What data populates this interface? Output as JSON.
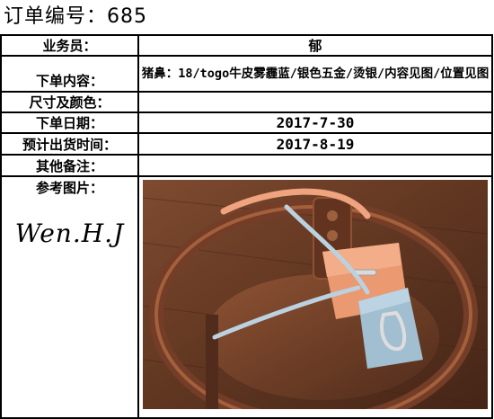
{
  "title": "订单编号：685",
  "fields": {
    "salesperson": {
      "label": "业务员：",
      "value": "郁"
    },
    "content": {
      "label": "下单内容：",
      "value": "猪鼻：18/togo牛皮雾霾蓝/银色五金/烫银/内容见图/位置见图"
    },
    "size_color": {
      "label": "尺寸及颜色：",
      "value": ""
    },
    "order_date": {
      "label": "下单日期：",
      "value": "2017-7-30"
    },
    "ship_date": {
      "label": "预计出货时间：",
      "value": "2017-8-19"
    },
    "notes": {
      "label": "其他备注：",
      "value": ""
    },
    "reference": {
      "label": "参考图片：",
      "signature": "Wen.H.J"
    }
  },
  "photo": {
    "subject": "two handbags (orange and light blue) with silver hardware on a wooden chair",
    "colors": {
      "wood": "#6b3a22",
      "bag_orange": "#e9946c",
      "bag_blue": "#a9c4d6",
      "hardware": "#d8d8d8"
    }
  }
}
